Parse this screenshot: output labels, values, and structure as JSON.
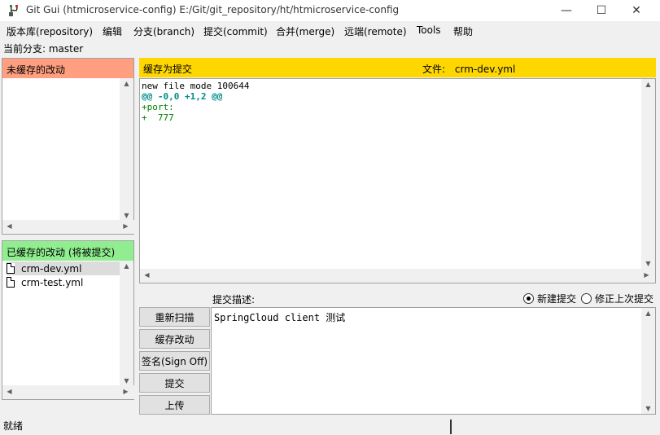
{
  "window": {
    "title": "Git Gui (htmicroservice-config) E:/Git/git_repository/ht/htmicroservice-config",
    "minimize_glyph": "—",
    "maximize_glyph": "☐",
    "close_glyph": "✕"
  },
  "menu": {
    "items": [
      "版本库(repository)",
      "编辑",
      "分支(branch)",
      "提交(commit)",
      "合并(merge)",
      "远端(remote)",
      "Tools",
      "帮助"
    ]
  },
  "branch": {
    "label": "当前分支: master"
  },
  "unstaged": {
    "header": "未缓存的改动",
    "files": []
  },
  "staged": {
    "header": "已缓存的改动 (将被提交)",
    "files": [
      "crm-dev.yml",
      "crm-test.yml"
    ],
    "selected_index": 0
  },
  "diff": {
    "header_label": "缓存为提交",
    "file_label": "文件:",
    "file_name": "crm-dev.yml",
    "lines": [
      {
        "text": "new file mode 100644",
        "kind": "meta"
      },
      {
        "text": "@@ -0,0 +1,2 @@",
        "kind": "hunk"
      },
      {
        "text": "+port:",
        "kind": "add"
      },
      {
        "text": "+  777",
        "kind": "add"
      }
    ]
  },
  "commit": {
    "message_label": "提交描述:",
    "new_commit_label": "新建提交",
    "amend_label": "修正上次提交",
    "selected_mode": "new",
    "message": "SpringCloud client 测试",
    "buttons": {
      "rescan": "重新扫描",
      "stage": "缓存改动",
      "signoff": "签名(Sign Off)",
      "commit": "提交",
      "push": "上传"
    }
  },
  "status": {
    "text": "就绪"
  },
  "colors": {
    "unstaged_header": "#ff9f80",
    "staged_header": "#90ee90",
    "diff_header": "#ffd700",
    "hunk": "#008b8b",
    "added": "#008000"
  }
}
